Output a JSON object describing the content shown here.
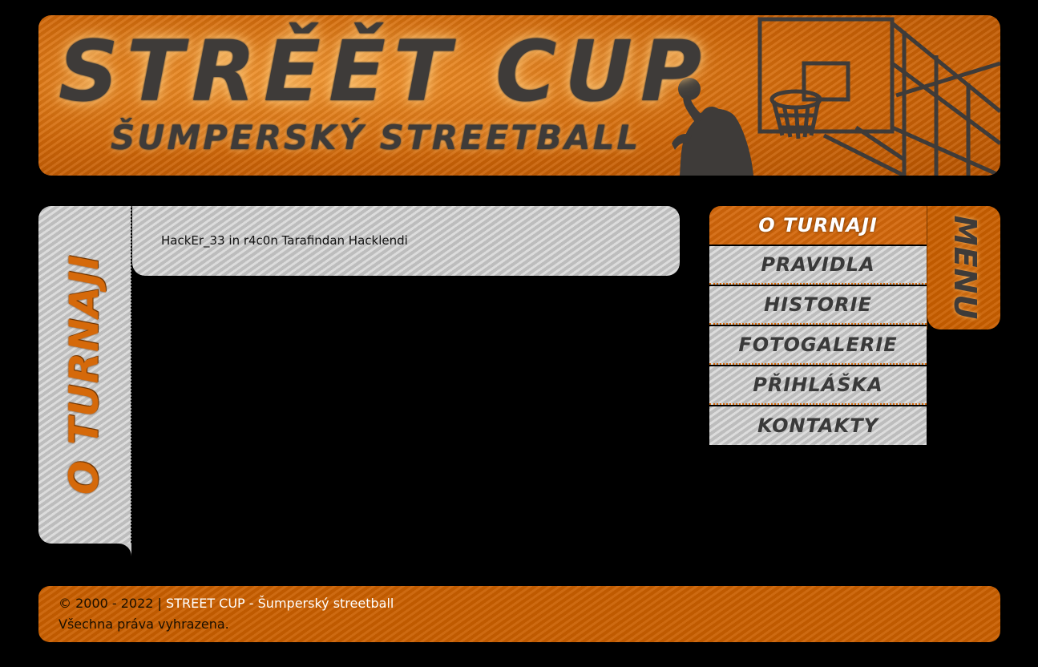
{
  "header": {
    "title": "STRĚĚT CUP",
    "subtitle": "ŠUMPERSKÝ STREETBALL"
  },
  "left_tab": {
    "label": "O TURNAJI"
  },
  "content": {
    "text": "HackEr_33 in r4c0n Tarafindan Hacklendi"
  },
  "menu": {
    "tab_label": "MENU",
    "items": [
      {
        "label": "O TURNAJI",
        "active": true
      },
      {
        "label": "PRAVIDLA"
      },
      {
        "label": "HISTORIE"
      },
      {
        "label": "FOTOGALERIE"
      },
      {
        "label": "PŘIHLÁŠKA"
      },
      {
        "label": "KONTAKTY"
      }
    ]
  },
  "footer": {
    "copyright": "© 2000 - 2022 |",
    "site_link": "STREET CUP - Šumperský streetball",
    "rights": "Všechna práva vyhrazena."
  },
  "colors": {
    "accent": "#c95f00",
    "panel": "#c9c9c9",
    "background": "#000000"
  }
}
